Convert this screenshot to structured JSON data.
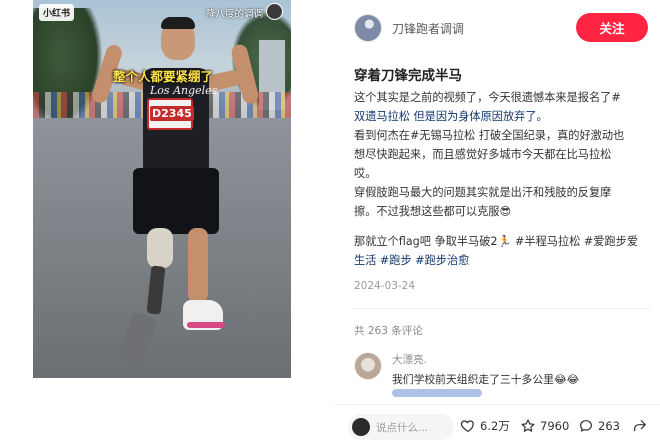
{
  "media": {
    "watermark_logo": "小红书",
    "watermark_user": "降八度的调调",
    "caption": "整个人都要紧绷了",
    "jersey_text": "Los Angeles",
    "bib_number": "D2345"
  },
  "author": {
    "name": "刀锋跑者调调",
    "follow_label": "关注",
    "follow_color": "#ff2442"
  },
  "note": {
    "title": "穿着刀锋完成半马",
    "body_lines": [
      "这个其实是之前的视频了，今天很遗憾本来是报名了#",
      "双遗马拉松 但是因为身体原因放弃了。",
      "看到何杰在#无锡马拉松 打破全国纪录，真的好激动也",
      "想尽快跑起来，而且感觉好多城市今天都在比马拉松",
      "哎。",
      "穿假肢跑马最大的问题其实就是出汗和残肢的反复摩",
      "擦。不过我想这些都可以克服😎"
    ],
    "tags_lines": [
      "那就立个flag吧 争取半马破2🏃 #半程马拉松 #爱跑步爱",
      "生活 #跑步 #跑步治愈"
    ],
    "date": "2024-03-24",
    "tag_color": "#13386c"
  },
  "comments": {
    "count_label": "共 263 条评论",
    "items": [
      {
        "user": "大漂亮.",
        "text": "我们学校前天组织走了三十多公里😂😂"
      }
    ]
  },
  "bottom_bar": {
    "input_placeholder": "说点什么...",
    "likes": "6.2万",
    "collects": "7960",
    "comments": "263",
    "icons": [
      "heart-icon",
      "star-icon",
      "comment-icon",
      "share-icon"
    ]
  }
}
